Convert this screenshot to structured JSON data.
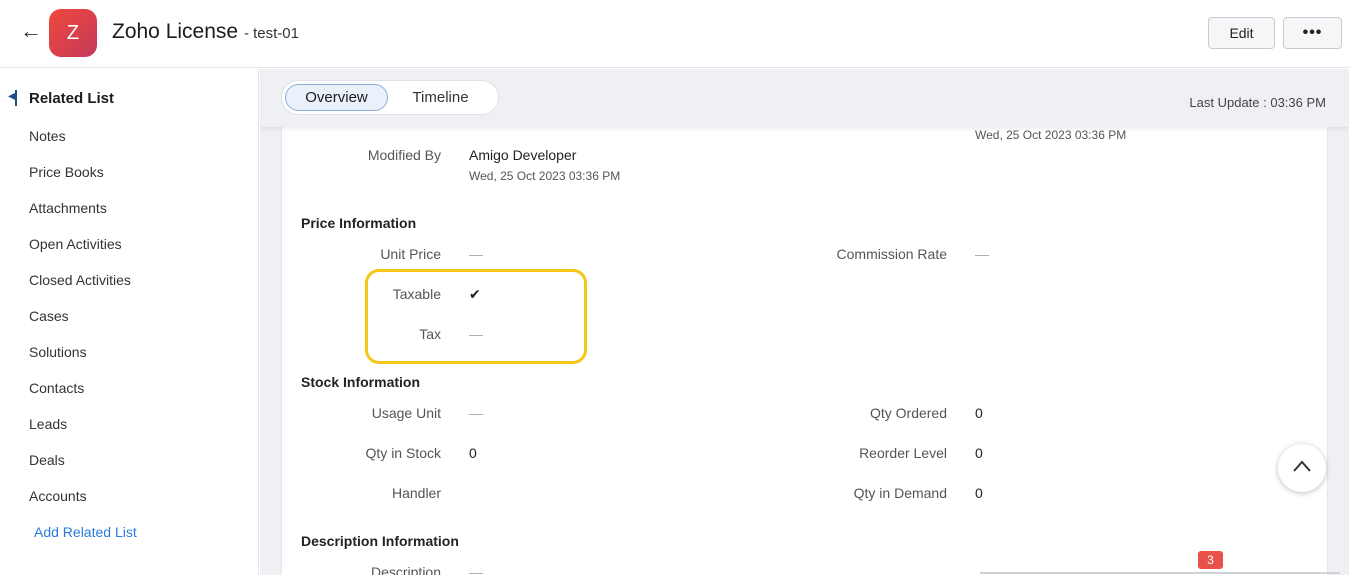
{
  "header": {
    "back_icon": "arrow-left-icon",
    "avatar_letter": "Z",
    "title": "Zoho License",
    "subtitle": "- test-01",
    "edit_label": "Edit",
    "more_label": "•••"
  },
  "sidebar": {
    "heading": "Related List",
    "items": [
      "Notes",
      "Price Books",
      "Attachments",
      "Open Activities",
      "Closed Activities",
      "Cases",
      "Solutions",
      "Contacts",
      "Leads",
      "Deals",
      "Accounts"
    ],
    "add_label": "Add Related List"
  },
  "tabs": {
    "overview": "Overview",
    "timeline": "Timeline",
    "active": "Overview"
  },
  "last_update": "Last Update : 03:36 PM",
  "record": {
    "top_right_timestamp": "Wed, 25 Oct 2023 03:36 PM",
    "modified_by_label": "Modified By",
    "modified_by_value": "Amigo Developer",
    "modified_by_time": "Wed, 25 Oct 2023 03:36 PM",
    "price_section": "Price Information",
    "unit_price_label": "Unit Price",
    "unit_price_value": "—",
    "commission_label": "Commission Rate",
    "commission_value": "—",
    "taxable_label": "Taxable",
    "taxable_value": "✔",
    "tax_label": "Tax",
    "tax_value": "—",
    "stock_section": "Stock Information",
    "usage_unit_label": "Usage Unit",
    "usage_unit_value": "—",
    "qty_ordered_label": "Qty Ordered",
    "qty_ordered_value": "0",
    "qty_stock_label": "Qty in Stock",
    "qty_stock_value": "0",
    "reorder_label": "Reorder Level",
    "reorder_value": "0",
    "handler_label": "Handler",
    "handler_value": "",
    "qty_demand_label": "Qty in Demand",
    "qty_demand_value": "0",
    "desc_section": "Description Information",
    "desc_label": "Description",
    "desc_value": "—"
  },
  "notification_count": "3",
  "colors": {
    "highlight": "#f5c518",
    "accent": "#2a7bde",
    "avatar": "#e8474a",
    "badge": "#e8524a"
  }
}
